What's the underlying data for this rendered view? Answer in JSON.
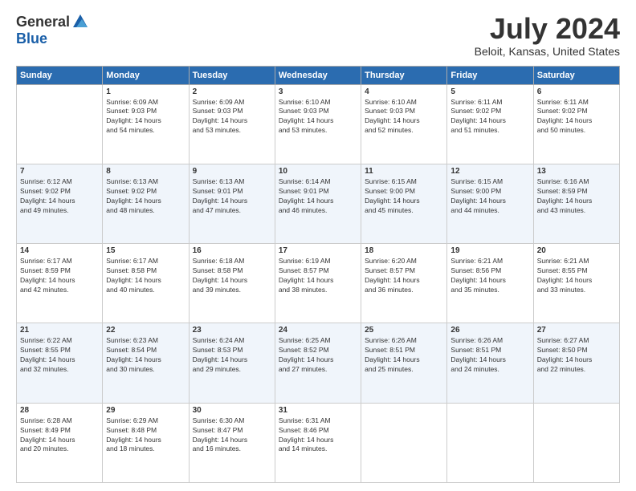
{
  "logo": {
    "general": "General",
    "blue": "Blue"
  },
  "title": {
    "month_year": "July 2024",
    "location": "Beloit, Kansas, United States"
  },
  "days_of_week": [
    "Sunday",
    "Monday",
    "Tuesday",
    "Wednesday",
    "Thursday",
    "Friday",
    "Saturday"
  ],
  "weeks": [
    [
      {
        "day": "",
        "info": ""
      },
      {
        "day": "1",
        "info": "Sunrise: 6:09 AM\nSunset: 9:03 PM\nDaylight: 14 hours\nand 54 minutes."
      },
      {
        "day": "2",
        "info": "Sunrise: 6:09 AM\nSunset: 9:03 PM\nDaylight: 14 hours\nand 53 minutes."
      },
      {
        "day": "3",
        "info": "Sunrise: 6:10 AM\nSunset: 9:03 PM\nDaylight: 14 hours\nand 53 minutes."
      },
      {
        "day": "4",
        "info": "Sunrise: 6:10 AM\nSunset: 9:03 PM\nDaylight: 14 hours\nand 52 minutes."
      },
      {
        "day": "5",
        "info": "Sunrise: 6:11 AM\nSunset: 9:02 PM\nDaylight: 14 hours\nand 51 minutes."
      },
      {
        "day": "6",
        "info": "Sunrise: 6:11 AM\nSunset: 9:02 PM\nDaylight: 14 hours\nand 50 minutes."
      }
    ],
    [
      {
        "day": "7",
        "info": "Sunrise: 6:12 AM\nSunset: 9:02 PM\nDaylight: 14 hours\nand 49 minutes."
      },
      {
        "day": "8",
        "info": "Sunrise: 6:13 AM\nSunset: 9:02 PM\nDaylight: 14 hours\nand 48 minutes."
      },
      {
        "day": "9",
        "info": "Sunrise: 6:13 AM\nSunset: 9:01 PM\nDaylight: 14 hours\nand 47 minutes."
      },
      {
        "day": "10",
        "info": "Sunrise: 6:14 AM\nSunset: 9:01 PM\nDaylight: 14 hours\nand 46 minutes."
      },
      {
        "day": "11",
        "info": "Sunrise: 6:15 AM\nSunset: 9:00 PM\nDaylight: 14 hours\nand 45 minutes."
      },
      {
        "day": "12",
        "info": "Sunrise: 6:15 AM\nSunset: 9:00 PM\nDaylight: 14 hours\nand 44 minutes."
      },
      {
        "day": "13",
        "info": "Sunrise: 6:16 AM\nSunset: 8:59 PM\nDaylight: 14 hours\nand 43 minutes."
      }
    ],
    [
      {
        "day": "14",
        "info": "Sunrise: 6:17 AM\nSunset: 8:59 PM\nDaylight: 14 hours\nand 42 minutes."
      },
      {
        "day": "15",
        "info": "Sunrise: 6:17 AM\nSunset: 8:58 PM\nDaylight: 14 hours\nand 40 minutes."
      },
      {
        "day": "16",
        "info": "Sunrise: 6:18 AM\nSunset: 8:58 PM\nDaylight: 14 hours\nand 39 minutes."
      },
      {
        "day": "17",
        "info": "Sunrise: 6:19 AM\nSunset: 8:57 PM\nDaylight: 14 hours\nand 38 minutes."
      },
      {
        "day": "18",
        "info": "Sunrise: 6:20 AM\nSunset: 8:57 PM\nDaylight: 14 hours\nand 36 minutes."
      },
      {
        "day": "19",
        "info": "Sunrise: 6:21 AM\nSunset: 8:56 PM\nDaylight: 14 hours\nand 35 minutes."
      },
      {
        "day": "20",
        "info": "Sunrise: 6:21 AM\nSunset: 8:55 PM\nDaylight: 14 hours\nand 33 minutes."
      }
    ],
    [
      {
        "day": "21",
        "info": "Sunrise: 6:22 AM\nSunset: 8:55 PM\nDaylight: 14 hours\nand 32 minutes."
      },
      {
        "day": "22",
        "info": "Sunrise: 6:23 AM\nSunset: 8:54 PM\nDaylight: 14 hours\nand 30 minutes."
      },
      {
        "day": "23",
        "info": "Sunrise: 6:24 AM\nSunset: 8:53 PM\nDaylight: 14 hours\nand 29 minutes."
      },
      {
        "day": "24",
        "info": "Sunrise: 6:25 AM\nSunset: 8:52 PM\nDaylight: 14 hours\nand 27 minutes."
      },
      {
        "day": "25",
        "info": "Sunrise: 6:26 AM\nSunset: 8:51 PM\nDaylight: 14 hours\nand 25 minutes."
      },
      {
        "day": "26",
        "info": "Sunrise: 6:26 AM\nSunset: 8:51 PM\nDaylight: 14 hours\nand 24 minutes."
      },
      {
        "day": "27",
        "info": "Sunrise: 6:27 AM\nSunset: 8:50 PM\nDaylight: 14 hours\nand 22 minutes."
      }
    ],
    [
      {
        "day": "28",
        "info": "Sunrise: 6:28 AM\nSunset: 8:49 PM\nDaylight: 14 hours\nand 20 minutes."
      },
      {
        "day": "29",
        "info": "Sunrise: 6:29 AM\nSunset: 8:48 PM\nDaylight: 14 hours\nand 18 minutes."
      },
      {
        "day": "30",
        "info": "Sunrise: 6:30 AM\nSunset: 8:47 PM\nDaylight: 14 hours\nand 16 minutes."
      },
      {
        "day": "31",
        "info": "Sunrise: 6:31 AM\nSunset: 8:46 PM\nDaylight: 14 hours\nand 14 minutes."
      },
      {
        "day": "",
        "info": ""
      },
      {
        "day": "",
        "info": ""
      },
      {
        "day": "",
        "info": ""
      }
    ]
  ]
}
